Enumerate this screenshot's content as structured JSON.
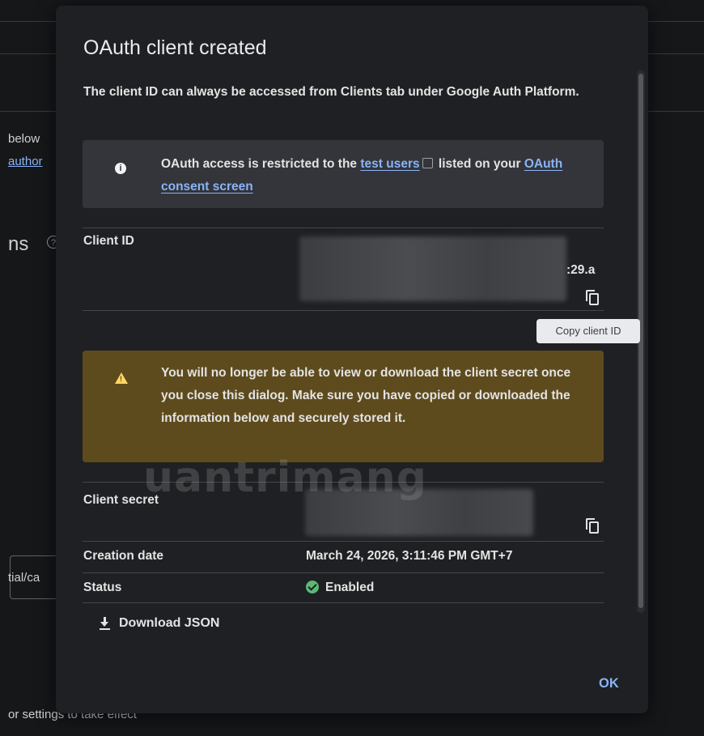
{
  "background": {
    "text_below": "below",
    "link_author": "author",
    "section_heading": "ns",
    "help_icon": "question-circle-icon",
    "field_value": "tial/ca",
    "footer_text": "or settings to take effect"
  },
  "dialog": {
    "title": "OAuth client created",
    "intro": "The client ID can always be accessed from Clients tab under Google Auth Platform.",
    "info": {
      "icon": "info-icon",
      "text_before": "OAuth access is restricted to the ",
      "link_test_users": "test users",
      "text_middle": " listed on your ",
      "link_consent": "OAuth consent screen"
    },
    "client_id": {
      "label": "Client ID",
      "visible_tail": ":29.a",
      "copy_icon": "copy-icon",
      "tooltip": "Copy client ID"
    },
    "warning": {
      "icon": "warning-icon",
      "text": "You will no longer be able to view or download the client secret once you close this dialog. Make sure you have copied or downloaded the information below and securely stored it."
    },
    "client_secret": {
      "label": "Client secret",
      "copy_icon": "copy-icon"
    },
    "creation_date": {
      "label": "Creation date",
      "value": "March 24, 2026, 3:11:46 PM GMT+7"
    },
    "status": {
      "label": "Status",
      "value": "Enabled",
      "icon": "check-circle-icon",
      "color": "#5bb974"
    },
    "download_label": "Download JSON",
    "ok_label": "OK"
  },
  "watermark": "uantrimang",
  "colors": {
    "dialog_bg": "#1f2023",
    "info_bg": "#33353a",
    "warning_bg": "#5e4b1d",
    "link": "#8ab4f8",
    "accent": "#8ab4f8"
  }
}
